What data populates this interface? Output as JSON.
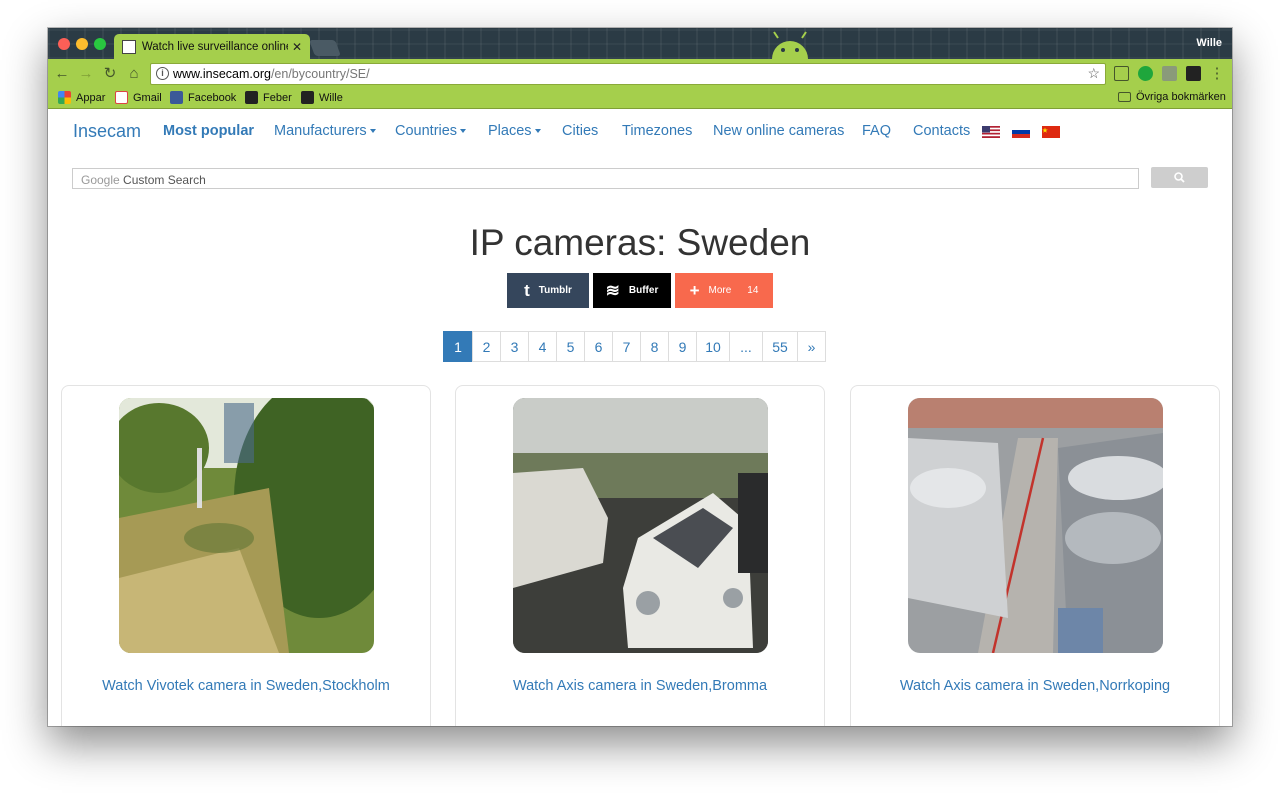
{
  "browser": {
    "tab_title": "Watch live surveillance online",
    "profile_name": "Wille",
    "url_domain": "www.insecam.org",
    "url_path": "/en/bycountry/SE/",
    "bookmarks": [
      "Appar",
      "Gmail",
      "Facebook",
      "Feber",
      "Wille"
    ],
    "other_bookmarks": "Övriga bokmärken",
    "accent_color": "#a5cf4c"
  },
  "nav": {
    "brand": "Insecam",
    "items": [
      "Most popular",
      "Manufacturers",
      "Countries",
      "Places",
      "Cities",
      "Timezones",
      "New online cameras",
      "FAQ",
      "Contacts"
    ],
    "flags": [
      "us-flag-icon",
      "russia-flag-icon",
      "china-flag-icon"
    ]
  },
  "search": {
    "placeholder_brand": "Google",
    "placeholder_text": "Custom Search"
  },
  "heading": "IP cameras: Sweden",
  "share": {
    "tumblr": "Tumblr",
    "buffer": "Buffer",
    "more": "More",
    "more_count": "14"
  },
  "pagination": [
    "1",
    "2",
    "3",
    "4",
    "5",
    "6",
    "7",
    "8",
    "9",
    "10",
    "...",
    "55",
    "»"
  ],
  "cameras": [
    {
      "caption": "Watch Vivotek camera in Sweden,Stockholm"
    },
    {
      "caption": "Watch Axis camera in Sweden,Bromma"
    },
    {
      "caption": "Watch Axis camera in Sweden,Norrkoping"
    }
  ]
}
